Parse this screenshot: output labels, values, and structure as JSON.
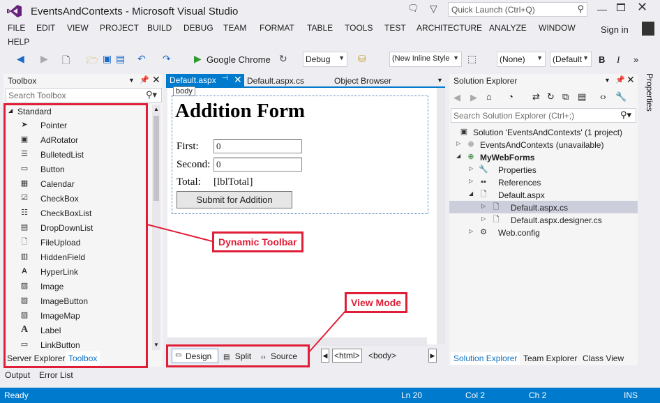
{
  "window": {
    "title": "EventsAndContexts - Microsoft Visual Studio",
    "quick_launch_placeholder": "Quick Launch (Ctrl+Q)",
    "sign_in": "Sign in"
  },
  "menu": {
    "items": [
      "FILE",
      "EDIT",
      "VIEW",
      "PROJECT",
      "BUILD",
      "DEBUG",
      "TEAM",
      "FORMAT",
      "TABLE",
      "TOOLS",
      "TEST",
      "ARCHITECTURE",
      "ANALYZE",
      "WINDOW",
      "HELP"
    ]
  },
  "toolbar": {
    "browser": "Google Chrome",
    "config": "Debug",
    "style_combo": "(New Inline Style",
    "class_combo": "(None)",
    "font_combo": "(Default",
    "bold": "B",
    "italic": "I"
  },
  "toolbox": {
    "title": "Toolbox",
    "search_placeholder": "Search Toolbox",
    "group": "Standard",
    "items": [
      "Pointer",
      "AdRotator",
      "BulletedList",
      "Button",
      "Calendar",
      "CheckBox",
      "CheckBoxList",
      "DropDownList",
      "FileUpload",
      "HiddenField",
      "HyperLink",
      "Image",
      "ImageButton",
      "ImageMap",
      "Label",
      "LinkButton"
    ],
    "bottom_tabs": [
      "Server Explorer",
      "Toolbox"
    ]
  },
  "editor": {
    "tabs": [
      "Default.aspx",
      "Default.aspx.cs",
      "Object Browser"
    ],
    "body_tag": "body",
    "form_title": "Addition Form",
    "first_label": "First:",
    "first_value": "0",
    "second_label": "Second:",
    "second_value": "0",
    "total_label": "Total:",
    "total_value": "[lblTotal]",
    "submit": "Submit for Addition",
    "view_modes": [
      "Design",
      "Split",
      "Source"
    ],
    "crumbs": [
      "<html>",
      "<body>"
    ]
  },
  "callouts": {
    "dynamic_toolbar": "Dynamic Toolbar",
    "view_mode": "View Mode"
  },
  "solution_explorer": {
    "title": "Solution Explorer",
    "search_placeholder": "Search Solution Explorer (Ctrl+;)",
    "tree": [
      "Solution 'EventsAndContexts' (1 project)",
      "EventsAndContexts (unavailable)",
      "MyWebForms",
      "Properties",
      "References",
      "Default.aspx",
      "Default.aspx.cs",
      "Default.aspx.designer.cs",
      "Web.config"
    ],
    "bottom_tabs": [
      "Solution Explorer",
      "Team Explorer",
      "Class View"
    ],
    "properties_strip": "Properties"
  },
  "bottom_panels": [
    "Output",
    "Error List"
  ],
  "status": {
    "state": "Ready",
    "ln": "Ln 20",
    "col": "Col 2",
    "ch": "Ch 2",
    "mode": "INS"
  },
  "colors": {
    "accent": "#007acc",
    "callout_red": "#e01e37",
    "vs_purple": "#68217a"
  }
}
